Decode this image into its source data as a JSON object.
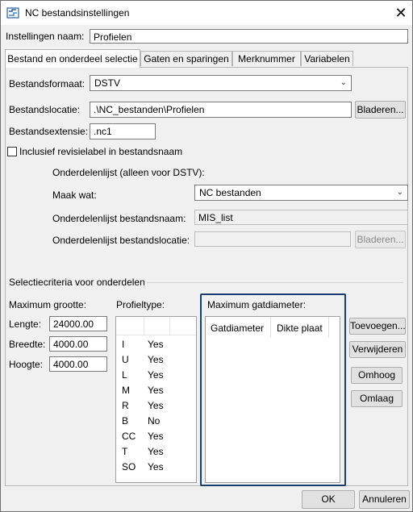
{
  "window": {
    "title": "NC bestandsinstellingen",
    "close_icon": "close-icon"
  },
  "settings_name": {
    "label": "Instellingen naam:",
    "value": "Profielen"
  },
  "tabs": [
    {
      "label": "Bestand en onderdeel selectie",
      "active": true
    },
    {
      "label": "Gaten en sparingen",
      "active": false
    },
    {
      "label": "Merknummer",
      "active": false
    },
    {
      "label": "Variabelen",
      "active": false
    }
  ],
  "file": {
    "format_label": "Bestandsformaat:",
    "format_value": "DSTV",
    "location_label": "Bestandslocatie:",
    "location_value": ".\\NC_bestanden\\Profielen",
    "browse_label": "Bladeren...",
    "extension_label": "Bestandsextensie:",
    "extension_value": ".nc1",
    "revision_checkbox_label": "Inclusief revisielabel in bestandsnaam",
    "revision_checked": false
  },
  "parts_list": {
    "heading": "Onderdelenlijst (alleen voor DSTV):",
    "make_label": "Maak wat:",
    "make_value": "NC bestanden",
    "filename_label": "Onderdelenlijst bestandsnaam:",
    "filename_value": "MIS_list",
    "location_label": "Onderdelenlijst bestandslocatie:",
    "location_value": "",
    "browse_label": "Bladeren..."
  },
  "selection": {
    "heading": "Selectiecriteria voor onderdelen",
    "max_size_label": "Maximum grootte:",
    "length_label": "Lengte:",
    "length_value": "24000.00",
    "width_label": "Breedte:",
    "width_value": "4000.00",
    "height_label": "Hoogte:",
    "height_value": "4000.00",
    "profile_type_label": "Profieltype:",
    "profile_types": [
      {
        "type": "I",
        "value": "Yes"
      },
      {
        "type": "U",
        "value": "Yes"
      },
      {
        "type": "L",
        "value": "Yes"
      },
      {
        "type": "M",
        "value": "Yes"
      },
      {
        "type": "R",
        "value": "Yes"
      },
      {
        "type": "B",
        "value": "No"
      },
      {
        "type": "CC",
        "value": "Yes"
      },
      {
        "type": "T",
        "value": "Yes"
      },
      {
        "type": "SO",
        "value": "Yes"
      }
    ],
    "max_hole_label": "Maximum gatdiameter:",
    "hole_columns": [
      "Gatdiameter",
      "Dikte plaat"
    ],
    "add_button": "Toevoegen...",
    "remove_button": "Verwijderen",
    "up_button": "Omhoog",
    "down_button": "Omlaag"
  },
  "footer": {
    "ok_label": "OK",
    "cancel_label": "Annuleren"
  }
}
